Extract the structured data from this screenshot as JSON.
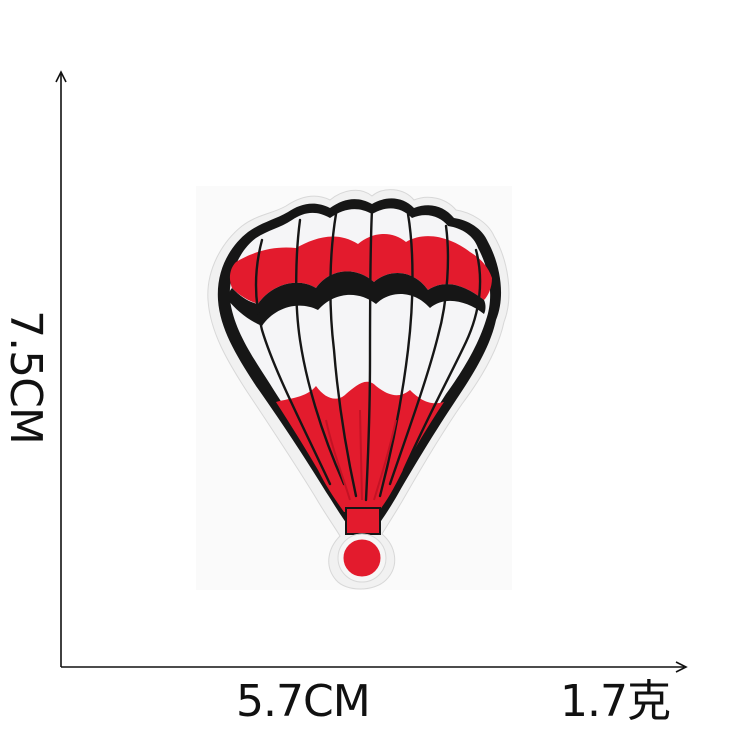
{
  "labels": {
    "height": "7.5CM",
    "width": "5.7CM",
    "weight": "1.7克"
  },
  "colors": {
    "background": "#ffffff",
    "axis": "#111111",
    "felt_backing": "#f3f3f3",
    "outline": "#161616",
    "balloon_white": "#f5f5f7",
    "balloon_red": "#e31b2d",
    "balloon_red_dark": "#c41224",
    "photo_shadow": "#eeeeee"
  },
  "objects": {
    "patch": "hot-air-balloon-embroidered-patch"
  }
}
